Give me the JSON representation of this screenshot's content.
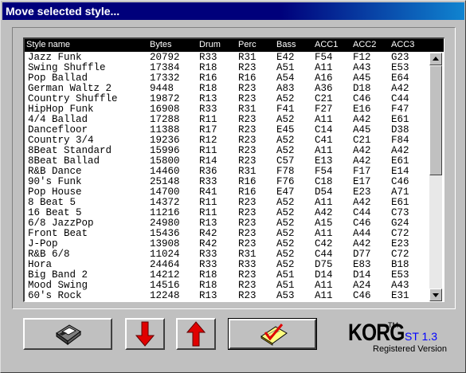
{
  "window": {
    "title": "Move selected style..."
  },
  "list": {
    "columns": [
      "Style name",
      "Bytes",
      "Drum",
      "Perc",
      "Bass",
      "ACC1",
      "ACC2",
      "ACC3"
    ],
    "rows": [
      [
        "Jazz Funk",
        "20792",
        "R33",
        "R31",
        "E42",
        "F54",
        "F12",
        "G23"
      ],
      [
        "Swing Shuffle",
        "17384",
        "R18",
        "R23",
        "A51",
        "A11",
        "A43",
        "E53"
      ],
      [
        "Pop Ballad",
        "17332",
        "R16",
        "R16",
        "A54",
        "A16",
        "A45",
        "E64"
      ],
      [
        "German Waltz 2",
        "9448",
        "R18",
        "R23",
        "A83",
        "A36",
        "D18",
        "A42"
      ],
      [
        "Country Shuffle",
        "19872",
        "R13",
        "R23",
        "A52",
        "C21",
        "C46",
        "C44"
      ],
      [
        "HipHop Funk",
        "16908",
        "R33",
        "R31",
        "F41",
        "F27",
        "E16",
        "F47"
      ],
      [
        "4/4 Ballad",
        "17288",
        "R11",
        "R23",
        "A52",
        "A11",
        "A42",
        "E61"
      ],
      [
        "Dancefloor",
        "11388",
        "R17",
        "R23",
        "E45",
        "C14",
        "A45",
        "D38"
      ],
      [
        "Country 3/4",
        "19236",
        "R12",
        "R23",
        "A52",
        "C41",
        "C21",
        "F84"
      ],
      [
        "8Beat Standard",
        "15996",
        "R11",
        "R23",
        "A52",
        "A11",
        "A42",
        "A42"
      ],
      [
        "8Beat Ballad",
        "15800",
        "R14",
        "R23",
        "C57",
        "E13",
        "A42",
        "E61"
      ],
      [
        "R&B Dance",
        "14460",
        "R36",
        "R31",
        "F78",
        "F54",
        "F17",
        "E14"
      ],
      [
        "90's Funk",
        "25148",
        "R33",
        "R16",
        "F76",
        "C18",
        "E17",
        "C46"
      ],
      [
        "Pop House",
        "14700",
        "R41",
        "R16",
        "E47",
        "D54",
        "E23",
        "A71"
      ],
      [
        "8 Beat 5",
        "14372",
        "R11",
        "R23",
        "A52",
        "A11",
        "A42",
        "E61"
      ],
      [
        "16 Beat 5",
        "11216",
        "R11",
        "R23",
        "A52",
        "A42",
        "C44",
        "C73"
      ],
      [
        "6/8 JazzPop",
        "24980",
        "R13",
        "R23",
        "A52",
        "A15",
        "C46",
        "G24"
      ],
      [
        "Front Beat",
        "15436",
        "R42",
        "R23",
        "A52",
        "A11",
        "A44",
        "C72"
      ],
      [
        "J-Pop",
        "13908",
        "R42",
        "R23",
        "A52",
        "C42",
        "A42",
        "E23"
      ],
      [
        "R&B 6/8",
        "11024",
        "R33",
        "R31",
        "A52",
        "C44",
        "D77",
        "C72"
      ],
      [
        "Hora",
        "24464",
        "R33",
        "R33",
        "A52",
        "D75",
        "E83",
        "B18"
      ],
      [
        "Big Band 2",
        "14212",
        "R18",
        "R23",
        "A51",
        "D14",
        "D14",
        "E53"
      ],
      [
        "Mood Swing",
        "14516",
        "R18",
        "R23",
        "A51",
        "A11",
        "A24",
        "A43"
      ],
      [
        "60's Rock",
        "12248",
        "R13",
        "R23",
        "A53",
        "A11",
        "C46",
        "E31"
      ]
    ]
  },
  "buttons": [
    {
      "name": "save-disk-button",
      "icon": "floppy-disk-icon"
    },
    {
      "name": "move-down-button",
      "icon": "arrow-down-icon",
      "color": "#e00000"
    },
    {
      "name": "move-up-button",
      "icon": "arrow-up-icon",
      "color": "#e00000"
    },
    {
      "name": "ok-button",
      "icon": "check-document-icon"
    }
  ],
  "brand": {
    "logo": "KORG",
    "trademark": "TM",
    "version": "ST 1.3",
    "registration": "Registered Version",
    "version_color": "#0000ff"
  }
}
